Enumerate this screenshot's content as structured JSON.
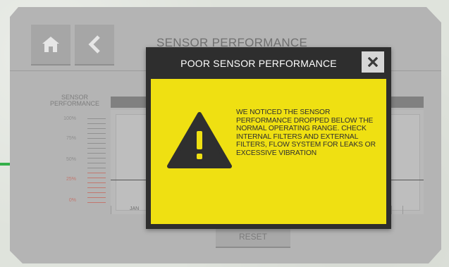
{
  "screen": {
    "title": "SENSOR PERFORMANCE",
    "home_icon": "home-icon",
    "back_icon": "chevron-left-icon",
    "performance_label": "SENSOR PERFORMANCE",
    "scale_ticks": [
      "100%",
      "75%",
      "50%",
      "25%",
      "0%"
    ],
    "month_label": "JAN",
    "reset_label": "RESET"
  },
  "dialog": {
    "title": "POOR SENSOR PERFORMANCE",
    "close_icon": "close-icon",
    "warning_icon": "warning-icon",
    "message": "WE NOTICED THE SENSOR PERFORMANCE DROPPED BELOW THE NORMAL OPERATING RANGE. CHECK INTERNAL FILTERS AND EXTERNAL FILTERS, FLOW SYSTEM FOR LEAKS OR EXCESSIVE VIBRATION"
  },
  "colors": {
    "dialog_body": "#efe012",
    "dialog_frame": "#2e2e2e",
    "low_range": "#c2776e",
    "accent_green": "#35b04a"
  }
}
